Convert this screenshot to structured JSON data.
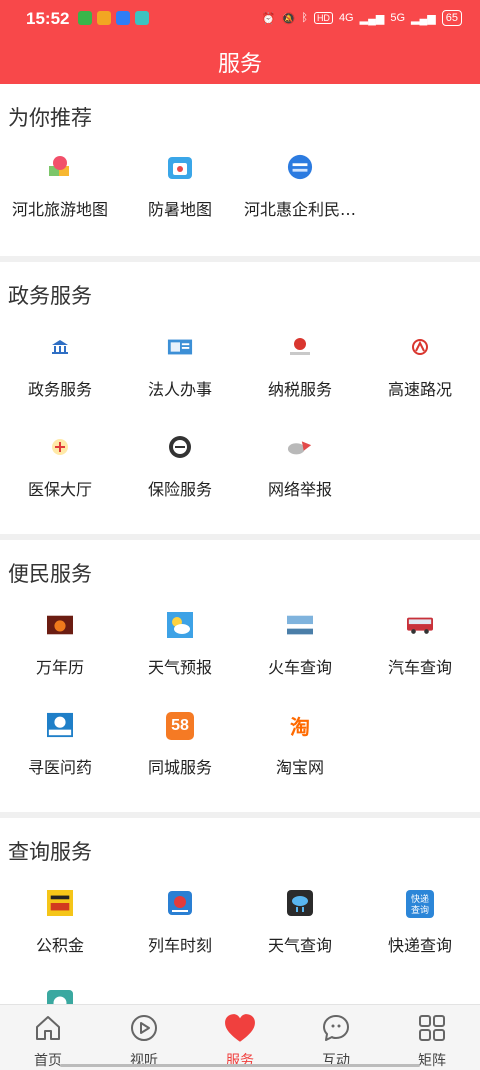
{
  "status_bar": {
    "time": "15:52",
    "battery": "65",
    "network_1": "4G",
    "network_2": "5G"
  },
  "header": {
    "title": "服务"
  },
  "sections": [
    {
      "title": "为你推荐",
      "items": [
        {
          "label": "河北旅游地图",
          "icon": "map-tourism-icon"
        },
        {
          "label": "防暑地图",
          "icon": "heat-map-icon"
        },
        {
          "label": "河北惠企利民…",
          "icon": "enterprise-icon"
        }
      ]
    },
    {
      "title": "政务服务",
      "items": [
        {
          "label": "政务服务",
          "icon": "government-icon"
        },
        {
          "label": "法人办事",
          "icon": "legal-person-icon"
        },
        {
          "label": "纳税服务",
          "icon": "tax-icon"
        },
        {
          "label": "高速路况",
          "icon": "highway-icon"
        },
        {
          "label": "医保大厅",
          "icon": "medical-insurance-icon"
        },
        {
          "label": "保险服务",
          "icon": "insurance-icon"
        },
        {
          "label": "网络举报",
          "icon": "report-icon"
        }
      ]
    },
    {
      "title": "便民服务",
      "items": [
        {
          "label": "万年历",
          "icon": "calendar-icon"
        },
        {
          "label": "天气预报",
          "icon": "weather-icon"
        },
        {
          "label": "火车查询",
          "icon": "train-icon"
        },
        {
          "label": "汽车查询",
          "icon": "bus-icon"
        },
        {
          "label": "寻医问药",
          "icon": "doctor-icon"
        },
        {
          "label": "同城服务",
          "icon": "58-city-icon"
        },
        {
          "label": "淘宝网",
          "icon": "taobao-icon"
        }
      ]
    },
    {
      "title": "查询服务",
      "items": [
        {
          "label": "公积金",
          "icon": "housing-fund-icon"
        },
        {
          "label": "列车时刻",
          "icon": "train-schedule-icon"
        },
        {
          "label": "天气查询",
          "icon": "weather-query-icon"
        },
        {
          "label": "快递查询",
          "icon": "express-icon"
        }
      ]
    }
  ],
  "icon_text": {
    "city58": "58",
    "taobao": "淘",
    "express": "快递\n查询"
  },
  "tabs": [
    {
      "label": "首页",
      "icon": "home-icon"
    },
    {
      "label": "视听",
      "icon": "play-icon"
    },
    {
      "label": "服务",
      "icon": "heart-icon",
      "active": true
    },
    {
      "label": "互动",
      "icon": "chat-icon"
    },
    {
      "label": "矩阵",
      "icon": "grid-icon"
    }
  ],
  "colors": {
    "brand": "#f8484a",
    "active_tab": "#f0403e"
  }
}
